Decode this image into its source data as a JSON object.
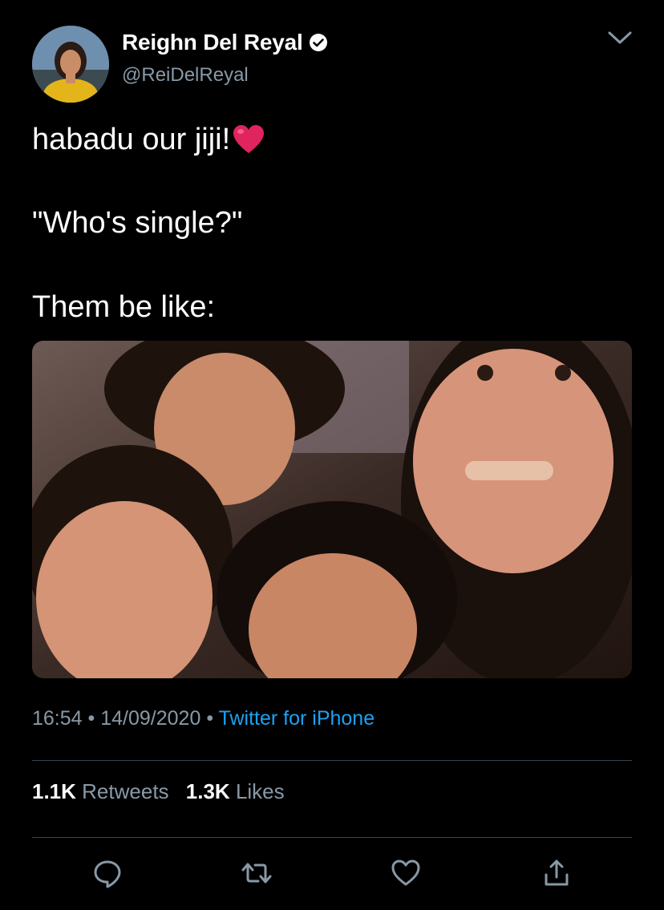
{
  "tweet": {
    "author": {
      "display_name": "Reighn Del Reyal",
      "handle": "@ReiDelReyal",
      "verified": true
    },
    "text_lines": [
      "habadu our jiji!",
      "\"Who's single?\"",
      "Them be like:"
    ],
    "emoji": "heart",
    "time": "16:54",
    "separator": "•",
    "date": "14/09/2020",
    "source": "Twitter for iPhone",
    "retweets_count": "1.1K",
    "retweets_label": "Retweets",
    "likes_count": "1.3K",
    "likes_label": "Likes"
  },
  "actions": [
    "reply-icon",
    "retweet-icon",
    "like-icon",
    "share-icon"
  ],
  "colors": {
    "background": "#000000",
    "text": "#ffffff",
    "secondary_text": "#8899a6",
    "link": "#1da1f2",
    "divider": "#38444d",
    "heart": "#e0245e"
  }
}
